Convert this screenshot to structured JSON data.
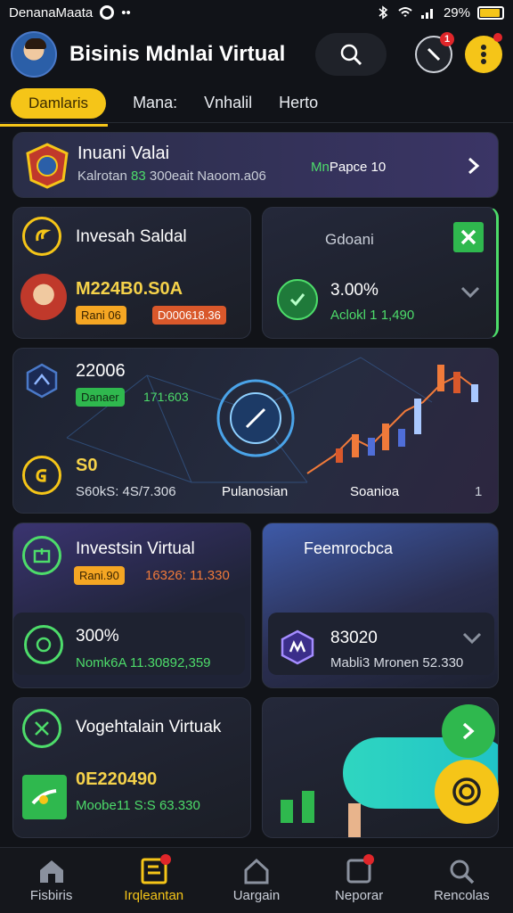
{
  "status_bar": {
    "app_name": "DenanaMaata",
    "dots": "••",
    "signal_text": "29%"
  },
  "header": {
    "title": "Bisinis Mdnlai Virtual",
    "notification_badge": "1"
  },
  "tabs": [
    {
      "label": "Damlaris",
      "active": true
    },
    {
      "label": "Mana:",
      "active": false
    },
    {
      "label": "Vnhalil",
      "active": false
    },
    {
      "label": "Herto",
      "active": false
    }
  ],
  "banner": {
    "title": "Inuani Valai",
    "subtitle_prefix": "Kalrotan",
    "subtitle_green": "83",
    "subtitle_rest": "300eait Naoom.a06",
    "right_green": "Mn",
    "right_text": "Papce 10"
  },
  "invest_card": {
    "title": "Invesah Saldal",
    "amount": "M224B0.S0A",
    "chip_orange": "Rani 06",
    "chip_red": "D000618.36"
  },
  "gdoani_card": {
    "title": "Gdoani",
    "percent": "3.00%",
    "sub": "Aclokl 1 1,490"
  },
  "chart_card": {
    "value": "22006",
    "chip_green": "Danaer",
    "chip_value": "171:603",
    "bottom_value": "S0",
    "bottom_sub": "S60kS: 4S/7.306",
    "center_label": "Pulanosian",
    "right_label": "Soanioa",
    "right_num": "1"
  },
  "invest_virtual": {
    "title": "Investsin Virtual",
    "chip": "Rani.90",
    "chip_value": "16326: 11.330",
    "percent": "300%",
    "sub": "Nomk6A 11.30892,359"
  },
  "feemro_card": {
    "title": "Feemrocbca",
    "value": "83020",
    "sub": "Mabli3 Mronen 52.330"
  },
  "vogelt_card": {
    "title": "Vogehtalain Virtuak",
    "value": "0E220490",
    "sub": "Moobe11 S:S 63.330"
  },
  "nav": [
    {
      "label": "Fisbiris",
      "active": false
    },
    {
      "label": "Irqleantan",
      "active": true
    },
    {
      "label": "Uargain",
      "active": false
    },
    {
      "label": "Neporar",
      "active": false
    },
    {
      "label": "Rencolas",
      "active": false
    }
  ],
  "colors": {
    "accent": "#f5c518",
    "green": "#4ddc6a",
    "background": "#111318"
  }
}
